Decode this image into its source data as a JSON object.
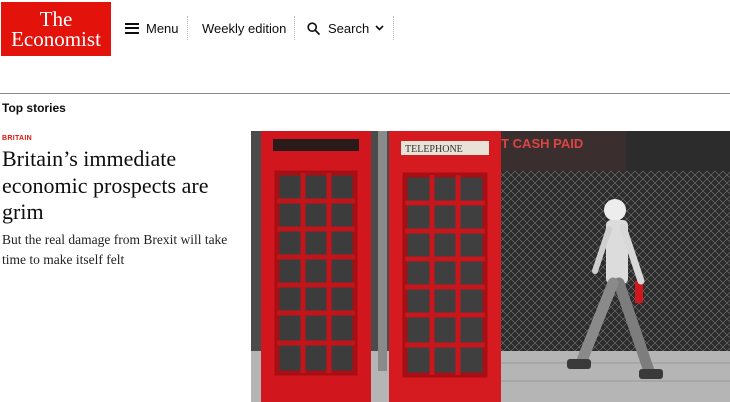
{
  "brand": {
    "line1": "The",
    "line2": "Economist",
    "color": "#e3120b"
  },
  "nav": {
    "menu_label": "Menu",
    "weekly_label": "Weekly edition",
    "search_label": "Search"
  },
  "icons": [
    "menu-icon",
    "search-icon",
    "chevron-down-icon"
  ],
  "top_stories": {
    "heading": "Top stories",
    "lead": {
      "kicker": "BRITAIN",
      "headline": "Britain’s immediate economic prospects are grim",
      "rubric": "But the real damage from Brexit will take time to make itself felt",
      "image_sign_text": [
        "TELEPHONE",
        "OT CASH PAID"
      ]
    }
  }
}
